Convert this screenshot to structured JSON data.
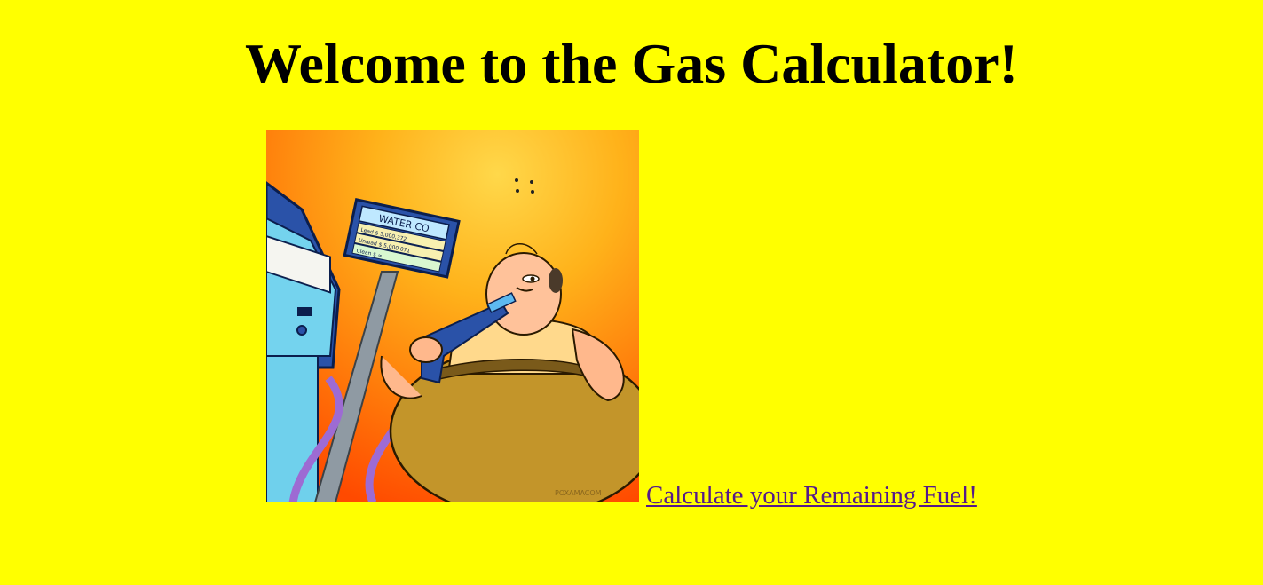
{
  "page": {
    "title": "Welcome to the Gas Calculator!",
    "background_color": "#ffff00"
  },
  "illustration": {
    "subject": "cartoon man drinking from a fuel pump nozzle",
    "pump_sign": {
      "brand": "WATER CO",
      "rows": [
        {
          "grade": "Lead",
          "price": "$ 5,000,372"
        },
        {
          "grade": "Unleaded",
          "price": "$ 5,000,071"
        },
        {
          "grade": "Clean",
          "price": "$ ∞"
        }
      ]
    },
    "signature": "POXAMACOM"
  },
  "link": {
    "label": "Calculate your Remaining Fuel!",
    "color": "#551a8b"
  }
}
